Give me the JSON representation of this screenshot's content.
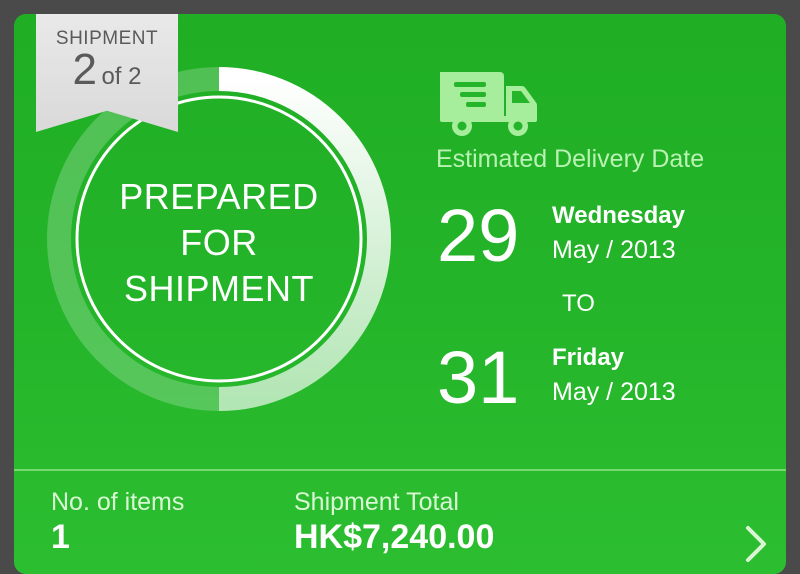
{
  "shipment_tag": {
    "label": "SHIPMENT",
    "current": "2",
    "of_total": "of 2"
  },
  "status": {
    "line1": "PREPARED",
    "line2": "FOR",
    "line3": "SHIPMENT",
    "progress_fraction": 0.5
  },
  "delivery": {
    "title": "Estimated Delivery Date",
    "from": {
      "day_num": "29",
      "weekday": "Wednesday",
      "month_year": "May / 2013"
    },
    "to_label": "TO",
    "to": {
      "day_num": "31",
      "weekday": "Friday",
      "month_year": "May / 2013"
    }
  },
  "summary": {
    "items_label": "No. of items",
    "items_value": "1",
    "total_label": "Shipment Total",
    "total_value": "HK$7,240.00"
  },
  "icons": {
    "truck": "truck-icon",
    "chevron": "chevron-right-icon"
  },
  "colors": {
    "card_green": "#25b52a",
    "label_light_green": "#b9f2b3",
    "tag_gray": "#dddddd"
  }
}
